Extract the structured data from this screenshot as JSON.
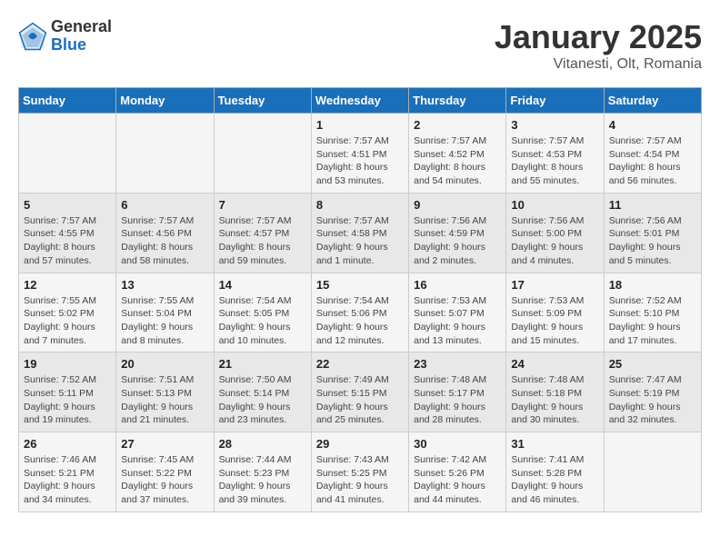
{
  "header": {
    "logo_general": "General",
    "logo_blue": "Blue",
    "title": "January 2025",
    "subtitle": "Vitanesti, Olt, Romania"
  },
  "weekdays": [
    "Sunday",
    "Monday",
    "Tuesday",
    "Wednesday",
    "Thursday",
    "Friday",
    "Saturday"
  ],
  "weeks": [
    [
      {
        "day": "",
        "info": ""
      },
      {
        "day": "",
        "info": ""
      },
      {
        "day": "",
        "info": ""
      },
      {
        "day": "1",
        "info": "Sunrise: 7:57 AM\nSunset: 4:51 PM\nDaylight: 8 hours\nand 53 minutes."
      },
      {
        "day": "2",
        "info": "Sunrise: 7:57 AM\nSunset: 4:52 PM\nDaylight: 8 hours\nand 54 minutes."
      },
      {
        "day": "3",
        "info": "Sunrise: 7:57 AM\nSunset: 4:53 PM\nDaylight: 8 hours\nand 55 minutes."
      },
      {
        "day": "4",
        "info": "Sunrise: 7:57 AM\nSunset: 4:54 PM\nDaylight: 8 hours\nand 56 minutes."
      }
    ],
    [
      {
        "day": "5",
        "info": "Sunrise: 7:57 AM\nSunset: 4:55 PM\nDaylight: 8 hours\nand 57 minutes."
      },
      {
        "day": "6",
        "info": "Sunrise: 7:57 AM\nSunset: 4:56 PM\nDaylight: 8 hours\nand 58 minutes."
      },
      {
        "day": "7",
        "info": "Sunrise: 7:57 AM\nSunset: 4:57 PM\nDaylight: 8 hours\nand 59 minutes."
      },
      {
        "day": "8",
        "info": "Sunrise: 7:57 AM\nSunset: 4:58 PM\nDaylight: 9 hours\nand 1 minute."
      },
      {
        "day": "9",
        "info": "Sunrise: 7:56 AM\nSunset: 4:59 PM\nDaylight: 9 hours\nand 2 minutes."
      },
      {
        "day": "10",
        "info": "Sunrise: 7:56 AM\nSunset: 5:00 PM\nDaylight: 9 hours\nand 4 minutes."
      },
      {
        "day": "11",
        "info": "Sunrise: 7:56 AM\nSunset: 5:01 PM\nDaylight: 9 hours\nand 5 minutes."
      }
    ],
    [
      {
        "day": "12",
        "info": "Sunrise: 7:55 AM\nSunset: 5:02 PM\nDaylight: 9 hours\nand 7 minutes."
      },
      {
        "day": "13",
        "info": "Sunrise: 7:55 AM\nSunset: 5:04 PM\nDaylight: 9 hours\nand 8 minutes."
      },
      {
        "day": "14",
        "info": "Sunrise: 7:54 AM\nSunset: 5:05 PM\nDaylight: 9 hours\nand 10 minutes."
      },
      {
        "day": "15",
        "info": "Sunrise: 7:54 AM\nSunset: 5:06 PM\nDaylight: 9 hours\nand 12 minutes."
      },
      {
        "day": "16",
        "info": "Sunrise: 7:53 AM\nSunset: 5:07 PM\nDaylight: 9 hours\nand 13 minutes."
      },
      {
        "day": "17",
        "info": "Sunrise: 7:53 AM\nSunset: 5:09 PM\nDaylight: 9 hours\nand 15 minutes."
      },
      {
        "day": "18",
        "info": "Sunrise: 7:52 AM\nSunset: 5:10 PM\nDaylight: 9 hours\nand 17 minutes."
      }
    ],
    [
      {
        "day": "19",
        "info": "Sunrise: 7:52 AM\nSunset: 5:11 PM\nDaylight: 9 hours\nand 19 minutes."
      },
      {
        "day": "20",
        "info": "Sunrise: 7:51 AM\nSunset: 5:13 PM\nDaylight: 9 hours\nand 21 minutes."
      },
      {
        "day": "21",
        "info": "Sunrise: 7:50 AM\nSunset: 5:14 PM\nDaylight: 9 hours\nand 23 minutes."
      },
      {
        "day": "22",
        "info": "Sunrise: 7:49 AM\nSunset: 5:15 PM\nDaylight: 9 hours\nand 25 minutes."
      },
      {
        "day": "23",
        "info": "Sunrise: 7:48 AM\nSunset: 5:17 PM\nDaylight: 9 hours\nand 28 minutes."
      },
      {
        "day": "24",
        "info": "Sunrise: 7:48 AM\nSunset: 5:18 PM\nDaylight: 9 hours\nand 30 minutes."
      },
      {
        "day": "25",
        "info": "Sunrise: 7:47 AM\nSunset: 5:19 PM\nDaylight: 9 hours\nand 32 minutes."
      }
    ],
    [
      {
        "day": "26",
        "info": "Sunrise: 7:46 AM\nSunset: 5:21 PM\nDaylight: 9 hours\nand 34 minutes."
      },
      {
        "day": "27",
        "info": "Sunrise: 7:45 AM\nSunset: 5:22 PM\nDaylight: 9 hours\nand 37 minutes."
      },
      {
        "day": "28",
        "info": "Sunrise: 7:44 AM\nSunset: 5:23 PM\nDaylight: 9 hours\nand 39 minutes."
      },
      {
        "day": "29",
        "info": "Sunrise: 7:43 AM\nSunset: 5:25 PM\nDaylight: 9 hours\nand 41 minutes."
      },
      {
        "day": "30",
        "info": "Sunrise: 7:42 AM\nSunset: 5:26 PM\nDaylight: 9 hours\nand 44 minutes."
      },
      {
        "day": "31",
        "info": "Sunrise: 7:41 AM\nSunset: 5:28 PM\nDaylight: 9 hours\nand 46 minutes."
      },
      {
        "day": "",
        "info": ""
      }
    ]
  ]
}
